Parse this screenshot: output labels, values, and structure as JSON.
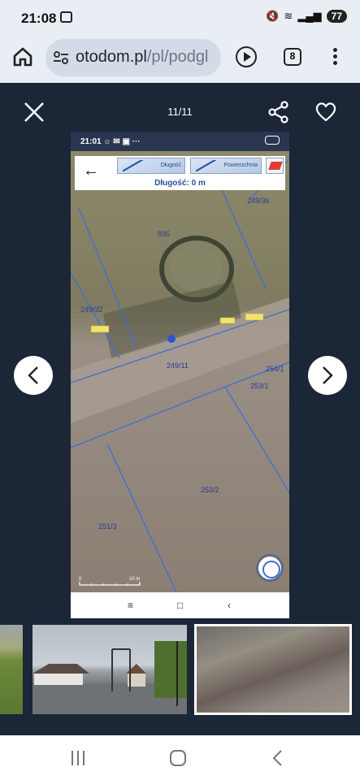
{
  "status_bar": {
    "time": "21:08",
    "battery": "77"
  },
  "browser": {
    "url_domain": "otodom.pl",
    "url_path": "/pl/podgl",
    "tab_count": "8"
  },
  "gallery": {
    "counter": "11/11"
  },
  "embedded_screenshot": {
    "status_time": "21:01",
    "status_icons": "☼ ✉ ▣ ···",
    "tool_length_label": "Długość",
    "tool_area_label": "Powierzchnia",
    "measure_label": "Długość: 0 m",
    "scale_start": "0",
    "scale_end": "10 m",
    "parcels": [
      "249/36",
      "895",
      "249/32",
      "249/11",
      "254/1",
      "253/1",
      "253/2",
      "251/3"
    ],
    "nav_icons": [
      "≡",
      "□",
      "‹"
    ]
  },
  "thumbnails": [
    {
      "name": "field photo"
    },
    {
      "name": "street view"
    },
    {
      "name": "map photo",
      "selected": true
    }
  ]
}
